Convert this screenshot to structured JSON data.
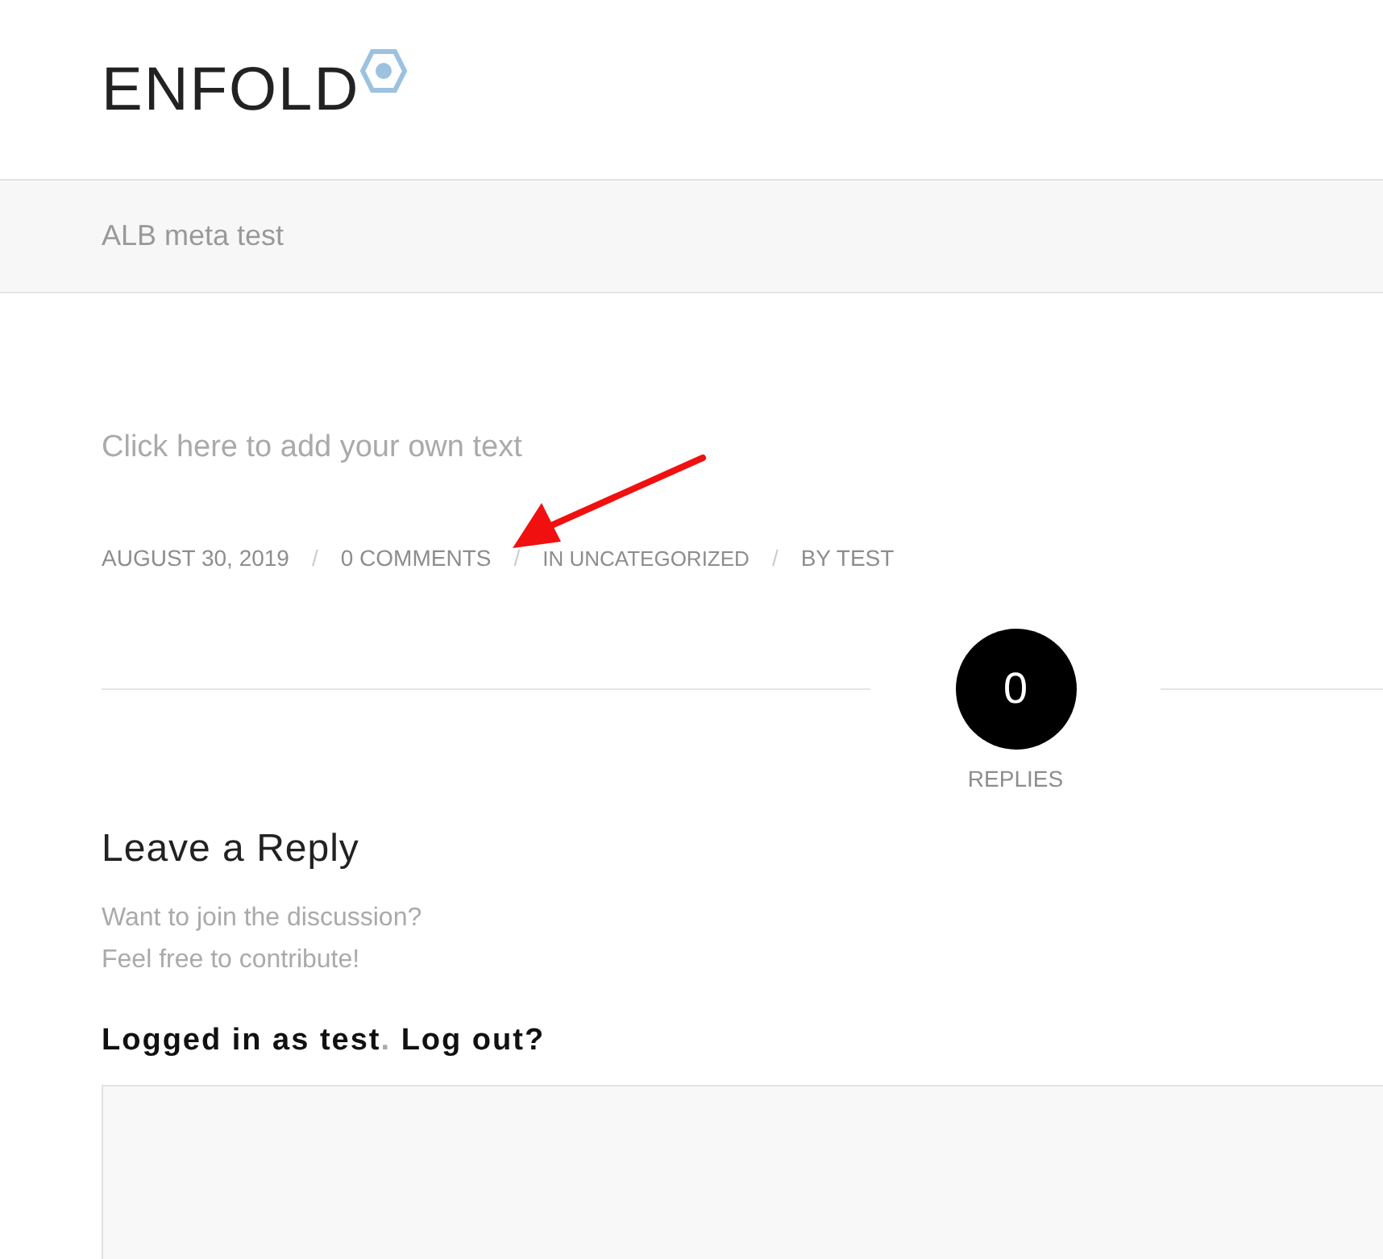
{
  "header": {
    "logo": "ENFOLD"
  },
  "title_bar": {
    "title": "ALB meta test"
  },
  "post": {
    "placeholder_text": "Click here to add your own text",
    "meta": [
      "AUGUST 30, 2019",
      "0 COMMENTS",
      "IN UNCATEGORIZED",
      "BY TEST"
    ],
    "meta_separators": [
      "/",
      "/",
      "/"
    ]
  },
  "replies": {
    "count": "0",
    "label": "REPLIES"
  },
  "reply_form": {
    "heading": "Leave a Reply",
    "intro_lines": [
      "Want to join the discussion?",
      "Feel free to contribute!"
    ],
    "logged_in": {
      "prefix": "Logged in as",
      "user": "test",
      "separator": ".",
      "logout": "Log out?"
    }
  }
}
